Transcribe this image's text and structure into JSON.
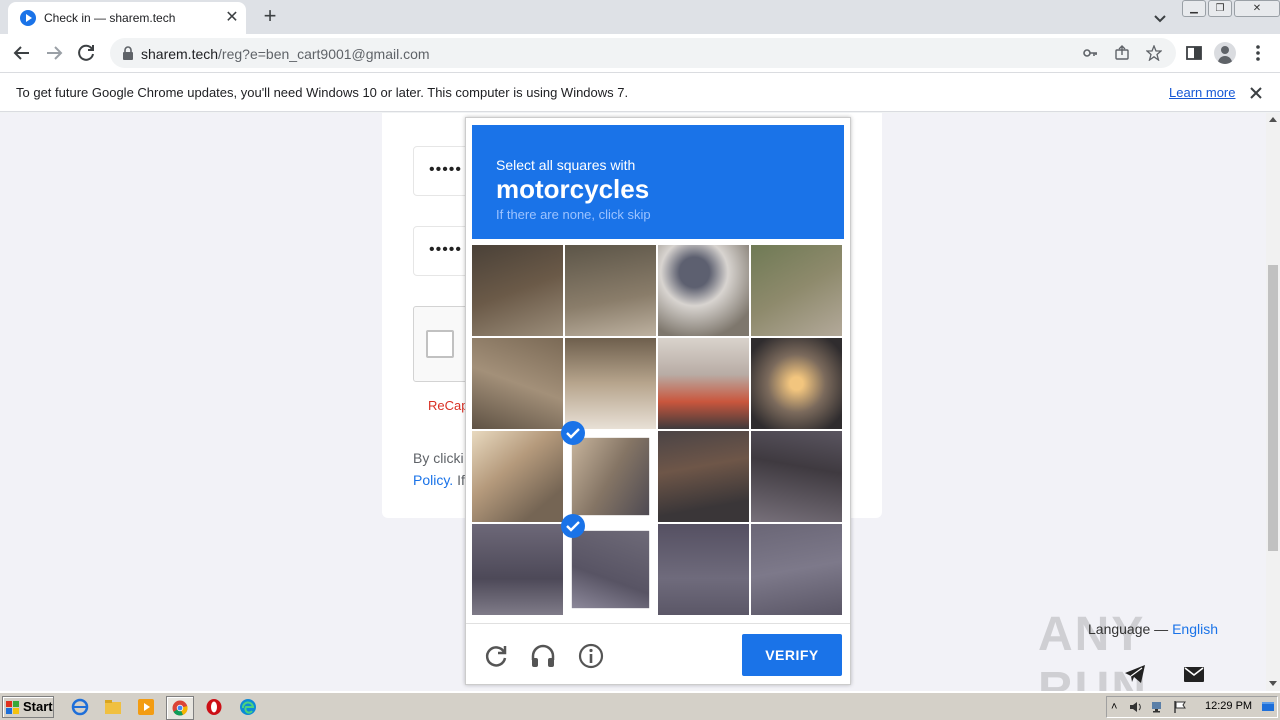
{
  "browser": {
    "tab_title": "Check in — sharem.tech",
    "url_host": "sharem.tech",
    "url_path": "/reg?e=ben_cart9001@gmail.com"
  },
  "infobar": {
    "message": "To get future Google Chrome updates, you'll need Windows 10 or later. This computer is using Windows 7.",
    "learn_more": "Learn more"
  },
  "form": {
    "password_mask": "•••••",
    "confirm_mask": "•••••",
    "recaptcha_label": "ReCap",
    "terms_line1": "By clicki",
    "terms_policy": "Policy.",
    "terms_line2_rest": " If"
  },
  "captcha": {
    "instruction": "Select all squares with",
    "target": "motorcycles",
    "hint": "If there are none, click skip",
    "verify": "VERIFY",
    "selected_tiles": [
      9,
      13
    ]
  },
  "footer": {
    "language_label": "Language — ",
    "language_value": "English",
    "watermark": "ANY RUN"
  },
  "taskbar": {
    "start": "Start",
    "clock": "12:29 PM"
  },
  "colors": {
    "captcha_blue": "#1a73e8",
    "recaptcha_red": "#d93025"
  }
}
